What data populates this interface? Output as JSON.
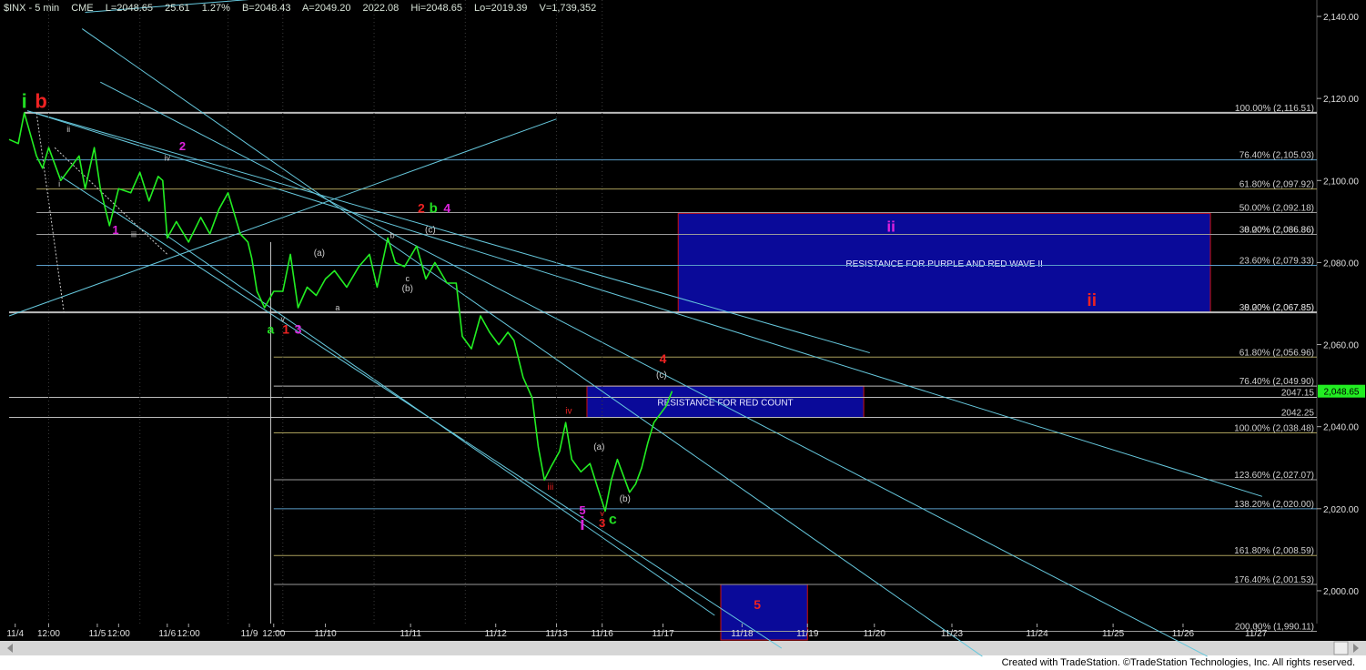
{
  "header": {
    "symbol": "$INX - 5 min",
    "exchange": "CME",
    "last": "L=2048.65",
    "change": "25.61",
    "pct": "1.27%",
    "bid": "B=2048.43",
    "ask": "A=2049.20",
    "open": "2022.08",
    "hi": "Hi=2048.65",
    "lo": "Lo=2019.39",
    "vol": "V=1,739,352"
  },
  "credit": "Created with TradeStation. ©TradeStation Technologies, Inc. All rights reserved.",
  "colors": {
    "background": "#000000",
    "price": "#22ee22",
    "channel": "#66c8dd",
    "fib_gray": "#9a9a9a",
    "fib_olive": "#a89e5a",
    "fib_blue": "#5a9cc8",
    "zone_fill": "#0a0a99",
    "zone_edge": "#cc1111",
    "red": "#ee2222",
    "magenta": "#dd22dd",
    "green": "#22dd22",
    "white": "#ffffff"
  },
  "chart_data": {
    "type": "line",
    "title": "$INX - 5 min",
    "ylim": [
      1992,
      2144
    ],
    "x_ticks": [
      "11/4",
      "12:00",
      "11/5",
      "12:00",
      "11/6",
      "12:00",
      "11/9",
      "12:00",
      "11/10",
      "11/11",
      "11/12",
      "11/13",
      "11/16",
      "11/17",
      "11/18",
      "11/19",
      "11/20",
      "11/23",
      "11/24",
      "11/25",
      "11/26",
      "11/27"
    ],
    "y_ticks": [
      "2,000.00",
      "2,020.00",
      "2,040.00",
      "2,060.00",
      "2,080.00",
      "2,100.00",
      "2,120.00",
      "2,140.00"
    ],
    "last_price": "2,048.65",
    "price_series": [
      {
        "t": 0.0,
        "v": 2110
      },
      {
        "t": 0.3,
        "v": 2109
      },
      {
        "t": 0.5,
        "v": 2116.5
      },
      {
        "t": 0.9,
        "v": 2106
      },
      {
        "t": 1.1,
        "v": 2103
      },
      {
        "t": 1.3,
        "v": 2108
      },
      {
        "t": 1.7,
        "v": 2100
      },
      {
        "t": 2.0,
        "v": 2103
      },
      {
        "t": 2.3,
        "v": 2106
      },
      {
        "t": 2.5,
        "v": 2098
      },
      {
        "t": 2.8,
        "v": 2108
      },
      {
        "t": 3.0,
        "v": 2098
      },
      {
        "t": 3.3,
        "v": 2089
      },
      {
        "t": 3.6,
        "v": 2098
      },
      {
        "t": 4.0,
        "v": 2097
      },
      {
        "t": 4.3,
        "v": 2102
      },
      {
        "t": 4.6,
        "v": 2095
      },
      {
        "t": 4.9,
        "v": 2101
      },
      {
        "t": 5.05,
        "v": 2100
      },
      {
        "t": 5.2,
        "v": 2086
      },
      {
        "t": 5.5,
        "v": 2090
      },
      {
        "t": 5.9,
        "v": 2085
      },
      {
        "t": 6.3,
        "v": 2091
      },
      {
        "t": 6.6,
        "v": 2087
      },
      {
        "t": 6.9,
        "v": 2093
      },
      {
        "t": 7.2,
        "v": 2097
      },
      {
        "t": 7.6,
        "v": 2087
      },
      {
        "t": 7.85,
        "v": 2085
      },
      {
        "t": 7.98,
        "v": 2081
      },
      {
        "t": 8.15,
        "v": 2073
      },
      {
        "t": 8.4,
        "v": 2069
      },
      {
        "t": 8.7,
        "v": 2073
      },
      {
        "t": 9.0,
        "v": 2073
      },
      {
        "t": 9.25,
        "v": 2082
      },
      {
        "t": 9.5,
        "v": 2069
      },
      {
        "t": 9.8,
        "v": 2074
      },
      {
        "t": 10.1,
        "v": 2072
      },
      {
        "t": 10.4,
        "v": 2076
      },
      {
        "t": 10.7,
        "v": 2078
      },
      {
        "t": 11.1,
        "v": 2074
      },
      {
        "t": 11.5,
        "v": 2079
      },
      {
        "t": 11.85,
        "v": 2082
      },
      {
        "t": 12.1,
        "v": 2074
      },
      {
        "t": 12.45,
        "v": 2086
      },
      {
        "t": 12.7,
        "v": 2080
      },
      {
        "t": 13.0,
        "v": 2079
      },
      {
        "t": 13.4,
        "v": 2084
      },
      {
        "t": 13.7,
        "v": 2076
      },
      {
        "t": 14.0,
        "v": 2080
      },
      {
        "t": 14.4,
        "v": 2075
      },
      {
        "t": 14.7,
        "v": 2075
      },
      {
        "t": 14.9,
        "v": 2062
      },
      {
        "t": 15.2,
        "v": 2059
      },
      {
        "t": 15.5,
        "v": 2067
      },
      {
        "t": 15.8,
        "v": 2063
      },
      {
        "t": 16.1,
        "v": 2060
      },
      {
        "t": 16.4,
        "v": 2063
      },
      {
        "t": 16.6,
        "v": 2061
      },
      {
        "t": 16.9,
        "v": 2052
      },
      {
        "t": 17.2,
        "v": 2047
      },
      {
        "t": 17.4,
        "v": 2035
      },
      {
        "t": 17.6,
        "v": 2027
      },
      {
        "t": 17.8,
        "v": 2030
      },
      {
        "t": 18.1,
        "v": 2034
      },
      {
        "t": 18.3,
        "v": 2041
      },
      {
        "t": 18.5,
        "v": 2032
      },
      {
        "t": 18.8,
        "v": 2029
      },
      {
        "t": 19.1,
        "v": 2031
      },
      {
        "t": 19.4,
        "v": 2024
      },
      {
        "t": 19.6,
        "v": 2019.4
      },
      {
        "t": 19.8,
        "v": 2027
      },
      {
        "t": 20.0,
        "v": 2032
      },
      {
        "t": 20.2,
        "v": 2028
      },
      {
        "t": 20.4,
        "v": 2024
      },
      {
        "t": 20.6,
        "v": 2026
      },
      {
        "t": 20.8,
        "v": 2030
      },
      {
        "t": 21.0,
        "v": 2036
      },
      {
        "t": 21.2,
        "v": 2041
      },
      {
        "t": 21.4,
        "v": 2043
      },
      {
        "t": 21.6,
        "v": 2045
      },
      {
        "t": 21.8,
        "v": 2048.65
      }
    ],
    "fib_levels": [
      {
        "label": "100.00% (2,116.51)",
        "value": 2116.51,
        "x0": 0.5,
        "color": "#bbbbbb",
        "w": 2
      },
      {
        "label": "76.40% (2,105.03)",
        "value": 2105.03,
        "x0": 0.9,
        "color": "#5a9cc8",
        "w": 1
      },
      {
        "label": "61.80% (2,097.92)",
        "value": 2097.92,
        "x0": 0.9,
        "color": "#a89e5a",
        "w": 1
      },
      {
        "label": "50.00% (2,092.18)",
        "value": 2092.18,
        "x0": 0.9,
        "color": "#9a9a9a",
        "w": 1
      },
      {
        "label": "38.20% (2,086.86)",
        "value": 2086.86,
        "x0": 0.9,
        "color": "#9a9a9a",
        "w": 1
      },
      {
        "label": "0.00% (2,086.86)",
        "value": 2086.86,
        "x0": 12.0,
        "color": "#9a9a9a",
        "w": 1
      },
      {
        "label": "23.60% (2,079.33)",
        "value": 2079.33,
        "x0": 0.9,
        "color": "#5a9cc8",
        "w": 1
      },
      {
        "label": "38.20% (2,067.85)",
        "value": 2067.85,
        "x0": 0.0,
        "color": "#bbbbbb",
        "w": 2
      },
      {
        "label": "0.00% (2,067.85)",
        "value": 2067.85,
        "x0": 8.0,
        "color": "#bbbbbb",
        "w": 1
      },
      {
        "label": "61.80% (2,056.96)",
        "value": 2056.96,
        "x0": 8.7,
        "color": "#a89e5a",
        "w": 1
      },
      {
        "label": "76.40% (2,049.90)",
        "value": 2049.9,
        "x0": 8.7,
        "color": "#bbbbbb",
        "w": 1
      },
      {
        "label": "2047.15",
        "value": 2047.15,
        "x0": 0.0,
        "color": "#bbbbbb",
        "w": 1
      },
      {
        "label": "2042.25",
        "value": 2042.25,
        "x0": 0.0,
        "color": "#bbbbbb",
        "w": 1
      },
      {
        "label": "100.00% (2,038.48)",
        "value": 2038.48,
        "x0": 8.7,
        "color": "#a89e5a",
        "w": 1
      },
      {
        "label": "123.60% (2,027.07)",
        "value": 2027.07,
        "x0": 8.7,
        "color": "#9a9a9a",
        "w": 1
      },
      {
        "label": "138.20% (2,020.00)",
        "value": 2020.0,
        "x0": 8.7,
        "color": "#5a9cc8",
        "w": 1
      },
      {
        "label": "161.80% (2,008.59)",
        "value": 2008.59,
        "x0": 8.7,
        "color": "#a89e5a",
        "w": 1
      },
      {
        "label": "176.40% (2,001.53)",
        "value": 2001.53,
        "x0": 8.7,
        "color": "#9a9a9a",
        "w": 1
      },
      {
        "label": "200.00% (1,990.11)",
        "value": 1990.11,
        "x0": 8.7,
        "color": "#9a9a9a",
        "w": 1
      }
    ],
    "zones": [
      {
        "label": "RESISTANCE FOR PURPLE AND RED WAVE II",
        "t0": 22.0,
        "t1": 39.5,
        "v0": 2092.0,
        "v1": 2067.85
      },
      {
        "label": "RESISTANCE FOR RED COUNT",
        "t0": 19.0,
        "t1": 28.1,
        "v0": 2049.9,
        "v1": 2042.25
      },
      {
        "label": "",
        "t0": 23.4,
        "t1": 26.25,
        "v0": 2001.53,
        "v1": 1988.0
      }
    ],
    "trendlines": [
      {
        "from": [
          2.5,
          2141
        ],
        "to": [
          12.9,
          2147
        ]
      },
      {
        "from": [
          0.0,
          2067
        ],
        "to": [
          18.0,
          2115
        ]
      },
      {
        "from": [
          0.6,
          2117
        ],
        "to": [
          28.3,
          2058
        ]
      },
      {
        "from": [
          0.6,
          2117
        ],
        "to": [
          41.2,
          2023
        ]
      },
      {
        "from": [
          2.4,
          2137
        ],
        "to": [
          32.0,
          1984
        ]
      },
      {
        "from": [
          3.0,
          2124
        ],
        "to": [
          39.4,
          1984
        ]
      },
      {
        "from": [
          1.7,
          2101
        ],
        "to": [
          25.4,
          1986
        ]
      },
      {
        "from": [
          5.1,
          2087
        ],
        "to": [
          23.2,
          1994
        ]
      }
    ],
    "dashed_lines": [
      {
        "from": [
          0.9,
          2116.5
        ],
        "to": [
          1.8,
          2068
        ]
      },
      {
        "from": [
          1.5,
          2108
        ],
        "to": [
          5.2,
          2082
        ]
      }
    ],
    "wave_labels": [
      {
        "text": "i",
        "t": 0.5,
        "v": 2117.7,
        "color": "#22dd22",
        "size": 22,
        "bold": true
      },
      {
        "text": "b",
        "t": 1.05,
        "v": 2117.7,
        "color": "#ee2222",
        "size": 22,
        "bold": true
      },
      {
        "text": "ii",
        "t": 1.95,
        "v": 2111.8,
        "color": "#cccccc",
        "size": 9,
        "bold": false
      },
      {
        "text": "i",
        "t": 1.65,
        "v": 2098.5,
        "color": "#cccccc",
        "size": 9,
        "bold": false
      },
      {
        "text": "iv",
        "t": 5.2,
        "v": 2104.8,
        "color": "#cccccc",
        "size": 9,
        "bold": false
      },
      {
        "text": "2",
        "t": 5.7,
        "v": 2107.4,
        "color": "#dd22dd",
        "size": 13,
        "bold": true
      },
      {
        "text": "1",
        "t": 3.5,
        "v": 2087.0,
        "color": "#dd22dd",
        "size": 13,
        "bold": true
      },
      {
        "text": "iii",
        "t": 4.1,
        "v": 2086.2,
        "color": "#cccccc",
        "size": 9,
        "bold": false
      },
      {
        "text": "(a)",
        "t": 10.2,
        "v": 2081.7,
        "color": "#cccccc",
        "size": 10,
        "bold": false
      },
      {
        "text": "a",
        "t": 10.8,
        "v": 2068.3,
        "color": "#cccccc",
        "size": 9,
        "bold": false
      },
      {
        "text": "v",
        "t": 9.0,
        "v": 2065.6,
        "color": "#cccccc",
        "size": 9,
        "bold": false
      },
      {
        "text": "a",
        "t": 8.6,
        "v": 2062.7,
        "color": "#22dd22",
        "size": 14,
        "bold": true
      },
      {
        "text": "1",
        "t": 9.1,
        "v": 2062.7,
        "color": "#ee2222",
        "size": 14,
        "bold": true
      },
      {
        "text": "3",
        "t": 9.5,
        "v": 2062.7,
        "color": "#dd22dd",
        "size": 14,
        "bold": true
      },
      {
        "text": "b",
        "t": 12.6,
        "v": 2086.0,
        "color": "#cccccc",
        "size": 9,
        "bold": false
      },
      {
        "text": "c",
        "t": 13.1,
        "v": 2075.4,
        "color": "#cccccc",
        "size": 9,
        "bold": false
      },
      {
        "text": "(b)",
        "t": 13.1,
        "v": 2073.0,
        "color": "#cccccc",
        "size": 10,
        "bold": false
      },
      {
        "text": "2",
        "t": 13.55,
        "v": 2092.2,
        "color": "#ee2222",
        "size": 14,
        "bold": true
      },
      {
        "text": "b",
        "t": 13.95,
        "v": 2092.2,
        "color": "#22dd22",
        "size": 15,
        "bold": true
      },
      {
        "text": "4",
        "t": 14.4,
        "v": 2092.2,
        "color": "#dd22dd",
        "size": 14,
        "bold": true
      },
      {
        "text": "(c)",
        "t": 13.85,
        "v": 2087.3,
        "color": "#cccccc",
        "size": 10,
        "bold": false
      },
      {
        "text": "ii",
        "t": 29.0,
        "v": 2087.5,
        "color": "#dd22dd",
        "size": 17,
        "bold": true
      },
      {
        "text": "ii",
        "t": 35.6,
        "v": 2069.4,
        "color": "#ee2222",
        "size": 19,
        "bold": true
      },
      {
        "text": "4",
        "t": 21.5,
        "v": 2055.5,
        "color": "#ee2222",
        "size": 14,
        "bold": true
      },
      {
        "text": "(c)",
        "t": 21.45,
        "v": 2051.9,
        "color": "#cccccc",
        "size": 10,
        "bold": false
      },
      {
        "text": "iv",
        "t": 18.4,
        "v": 2043.1,
        "color": "#ee2222",
        "size": 10,
        "bold": false
      },
      {
        "text": "(a)",
        "t": 19.4,
        "v": 2034.4,
        "color": "#cccccc",
        "size": 10,
        "bold": false
      },
      {
        "text": "iii",
        "t": 17.8,
        "v": 2024.6,
        "color": "#ee2222",
        "size": 10,
        "bold": false
      },
      {
        "text": "(b)",
        "t": 20.25,
        "v": 2021.7,
        "color": "#cccccc",
        "size": 10,
        "bold": false
      },
      {
        "text": "5",
        "t": 18.85,
        "v": 2018.6,
        "color": "#dd22dd",
        "size": 13,
        "bold": true
      },
      {
        "text": "v",
        "t": 19.5,
        "v": 2018.2,
        "color": "#ee2222",
        "size": 9,
        "bold": false
      },
      {
        "text": "i",
        "t": 18.85,
        "v": 2014.9,
        "color": "#dd22dd",
        "size": 20,
        "bold": true
      },
      {
        "text": "3",
        "t": 19.5,
        "v": 2015.5,
        "color": "#ee2222",
        "size": 13,
        "bold": true
      },
      {
        "text": "c",
        "t": 19.85,
        "v": 2016.3,
        "color": "#22dd22",
        "size": 16,
        "bold": true
      },
      {
        "text": "5",
        "t": 24.6,
        "v": 1995.6,
        "color": "#ee2222",
        "size": 14,
        "bold": true
      }
    ]
  }
}
